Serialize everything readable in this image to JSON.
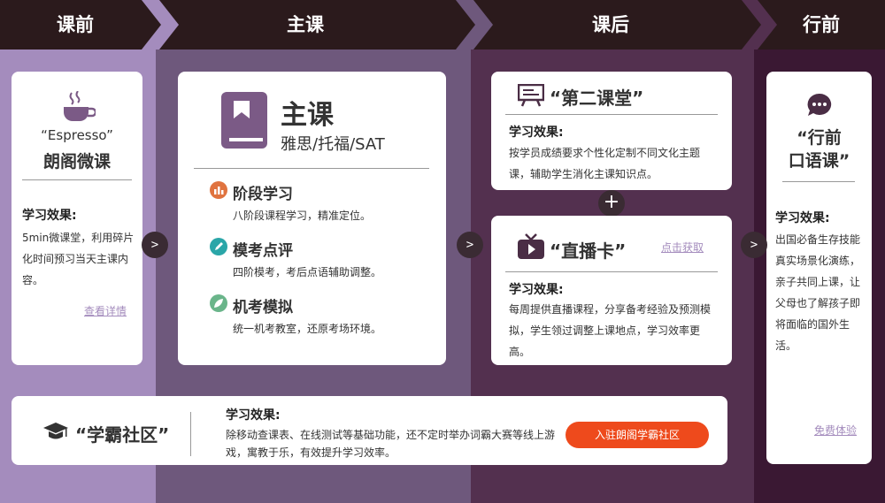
{
  "header": {
    "stage1": "课前",
    "stage2": "主课",
    "stage3": "课后",
    "stage4": "行前"
  },
  "pre": {
    "icon": "coffee-cup-icon",
    "subtitle": "“Espresso”",
    "title": "朗阁微课",
    "effect_title": "学习效果:",
    "effect_body": "5min微课堂，利用碎片化时间预习当天主课内容。",
    "link": "查看详情"
  },
  "main": {
    "icon": "book-icon",
    "title": "主课",
    "subtitle": "雅思/托福/SAT",
    "items": [
      {
        "icon": "bar-chart-icon",
        "title": "阶段学习",
        "desc": "八阶段课程学习，精准定位。"
      },
      {
        "icon": "pen-icon",
        "title": "模考点评",
        "desc": "四阶模考，考后点语辅助调整。"
      },
      {
        "icon": "leaf-icon",
        "title": "机考模拟",
        "desc": "统一机考教室，还原考场环境。"
      }
    ]
  },
  "post": {
    "second_title": "“第二课堂”",
    "second_icon": "classroom-board-icon",
    "second_effect_title": "学习效果:",
    "second_effect_body": "按学员成绩要求个性化定制不同文化主题课，辅助学生消化主课知识点。",
    "plus": "+",
    "live_title": "“直播卡”",
    "live_icon": "tv-play-icon",
    "live_link": "点击获取",
    "live_effect_title": "学习效果:",
    "live_effect_body": "每周提供直播课程，分享备考经验及预测模拟，学生领过调整上课地点，学习效率更高。"
  },
  "trip": {
    "icon": "chat-bubble-icon",
    "title_line1": "“行前",
    "title_line2": "口语课”",
    "effect_title": "学习效果:",
    "effect_body": "出国必备生存技能真实场景化演练，亲子共同上课，让父母也了解孩子即将面临的国外生活。",
    "link": "免费体验"
  },
  "community": {
    "icon": "graduation-cap-icon",
    "title": "“学霸社区”",
    "effect_title": "学习效果:",
    "effect_body": "除移动查课表、在线测试等基础功能，还不定时举办词霸大赛等线上游戏，寓教于乐，有效提升学习效率。",
    "button": "入驻朗阁学霸社区"
  },
  "nav_arrow": ">",
  "colors": {
    "header_bg": "#2b1a1c",
    "col1": "#a48cbd",
    "col2": "#6e587c",
    "col3": "#53304f",
    "col4": "#3a1833",
    "accent_orange": "#ee4a1c",
    "icon_purple": "#7b5a86"
  }
}
